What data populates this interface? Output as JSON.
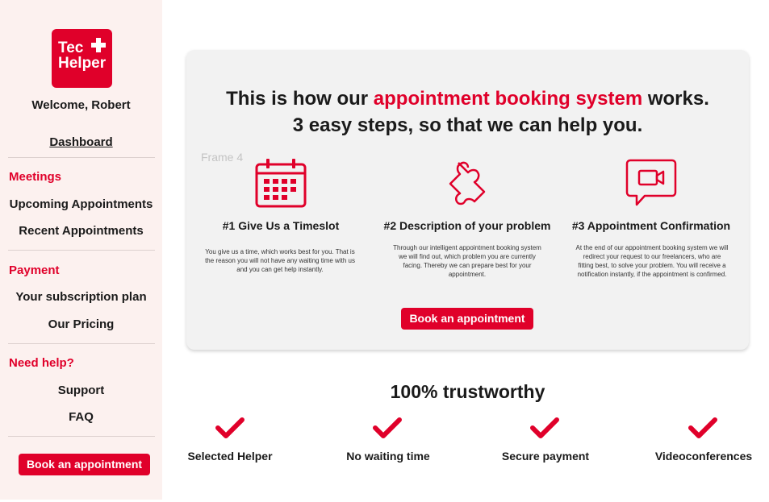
{
  "colors": {
    "accent": "#e0002a",
    "sidebar_bg": "#fcf1ef",
    "card_bg": "#f2f2f2"
  },
  "logo": {
    "line1": "Tec",
    "line2": "Helper",
    "icon": "medical-cross-icon"
  },
  "sidebar": {
    "welcome": "Welcome, Robert",
    "dashboard": "Dashboard",
    "meetings_title": "Meetings",
    "upcoming": "Upcoming Appointments",
    "recent": "Recent Appointments",
    "payment_title": "Payment",
    "subscription": "Your subscription plan",
    "pricing": "Our Pricing",
    "help_title": "Need help?",
    "support": "Support",
    "faq": "FAQ",
    "book_button": "Book an appointment"
  },
  "hero": {
    "line1_pre": "This is how our ",
    "line1_accent": "appointment booking system",
    "line1_post": " works.",
    "line2": "3 easy steps, so that we can help you.",
    "frame_label": "Frame 4",
    "book_button": "Book an appointment"
  },
  "steps": [
    {
      "icon": "calendar-icon",
      "title": "#1 Give Us a Timeslot",
      "desc": "You give us a time, which works best for you. That is the reason you will not have any waiting time with us and you can get help instantly."
    },
    {
      "icon": "puzzle-piece-icon",
      "title": "#2 Description of your problem",
      "desc": "Through our intelligent appointment booking system we will find out, which problem you are currently facing. Thereby we can prepare best for your appointment."
    },
    {
      "icon": "video-chat-icon",
      "title": "#3 Appointment Confirmation",
      "desc": "At the end of our appointment booking system we will redirect your request to our freelancers, who are fitting best, to solve your problem. You will receive a notification instantly, if the appointment is confirmed."
    }
  ],
  "trust": {
    "title": "100% trustworthy",
    "items": [
      {
        "icon": "checkmark-icon",
        "label": "Selected Helper"
      },
      {
        "icon": "checkmark-icon",
        "label": "No waiting time"
      },
      {
        "icon": "checkmark-icon",
        "label": "Secure payment"
      },
      {
        "icon": "checkmark-icon",
        "label": "Videoconferences"
      }
    ]
  }
}
